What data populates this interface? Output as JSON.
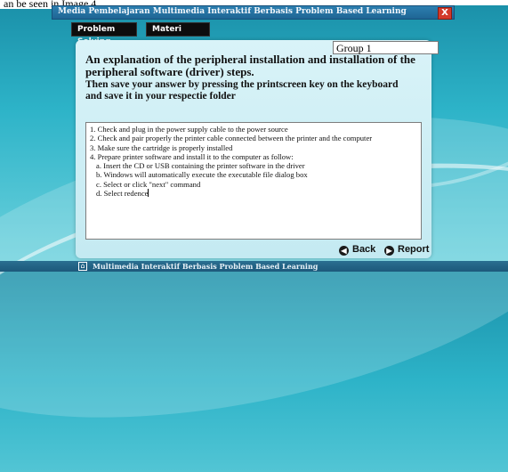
{
  "caption_fragment": "an be seen in Image 4.",
  "window": {
    "title": "Media Pembelajaran Multimedia Interaktif Berbasis Problem Based Learning",
    "close_label": "X"
  },
  "nav": {
    "problem_solving": "Problem Solving",
    "materi": "Materi"
  },
  "group_label": "Group 1",
  "instructions": {
    "heading": "An explanation of the peripheral installation and installation of the peripheral software (driver) steps.",
    "subheading": "Then save your answer by pressing the printscreen key on the keyboard and save it in your respectie folder"
  },
  "answer_lines": [
    "1. Check and plug in the power supply cable to the power source",
    "2. Check and pair properly the printer cable connected between the printer and the computer",
    "3. Make sure the cartridge is properly installed",
    "4. Prepare printer software and install it to the computer as follow:",
    "a. Insert the CD or USB containing the printer software in the driver",
    "b. Windows will automatically execute the executable file dialog box",
    "c. Select or click \"next\" command",
    "d. Select redence"
  ],
  "buttons": {
    "back": "Back",
    "report": "Report"
  },
  "footer_text": "Multimedia Interaktif Berbasis Problem Based Learning",
  "icons": {
    "close": "close-icon",
    "back": "back-arrow-icon",
    "report": "report-arrow-icon",
    "home": "home-icon"
  }
}
